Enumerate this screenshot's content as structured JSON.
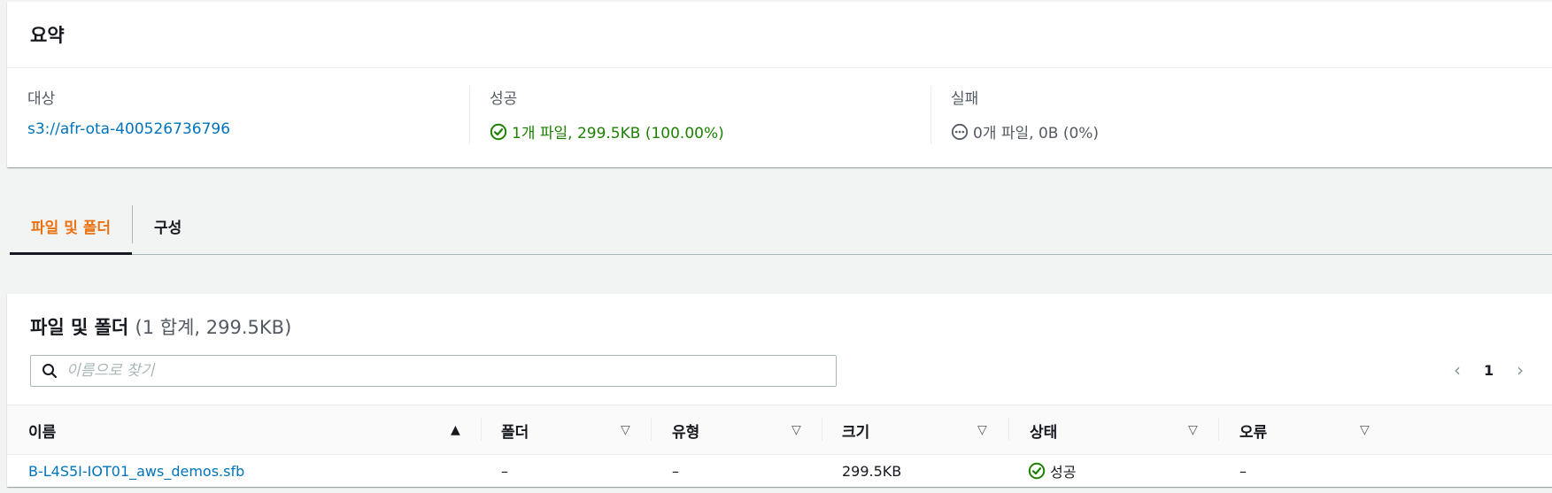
{
  "summary": {
    "title": "요약",
    "destination": {
      "label": "대상",
      "value": "s3://afr-ota-400526736796"
    },
    "succeeded": {
      "label": "성공",
      "value": "1개 파일, 299.5KB (100.00%)"
    },
    "failed": {
      "label": "실패",
      "value": "0개 파일, 0B (0%)"
    }
  },
  "tabs": [
    {
      "label": "파일 및 폴더",
      "active": true
    },
    {
      "label": "구성",
      "active": false
    }
  ],
  "files": {
    "title": "파일 및 폴더",
    "count": "(1 합계, 299.5KB)",
    "search_placeholder": "이름으로 찾기",
    "page": "1",
    "columns": [
      "이름",
      "폴더",
      "유형",
      "크기",
      "상태",
      "오류"
    ],
    "rows": [
      {
        "name": "B-L4S5I-IOT01_aws_demos.sfb",
        "folder": "–",
        "type": "–",
        "size": "299.5KB",
        "status": "성공",
        "error": "–"
      }
    ]
  },
  "colors": {
    "accent": "#ec7211",
    "link": "#0073bb",
    "success": "#1d8102"
  }
}
